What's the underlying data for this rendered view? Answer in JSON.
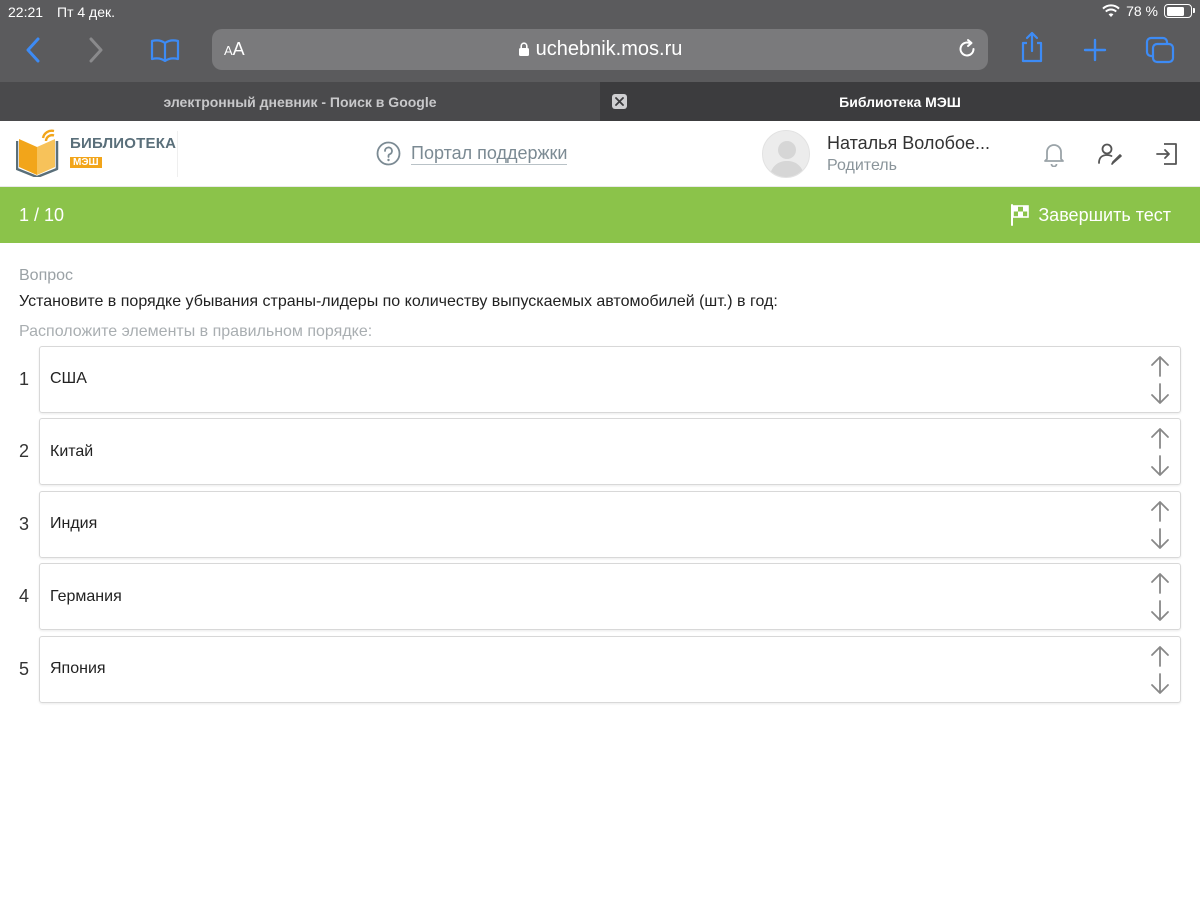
{
  "status": {
    "time": "22:21",
    "date": "Пт 4 дек.",
    "battery": "78 %",
    "battery_level": 0.78
  },
  "browser": {
    "url_aa": "AA",
    "url": "uchebnik.mos.ru",
    "tabs": [
      {
        "title": "электронный дневник - Поиск в Google",
        "active": false
      },
      {
        "title": "Библиотека МЭШ",
        "active": true
      }
    ]
  },
  "header": {
    "logo_name": "БИБЛИОТЕКА",
    "logo_sub": "МЭШ",
    "support": "Портал поддержки",
    "user_name": "Наталья Волобое...",
    "user_role": "Родитель"
  },
  "testbar": {
    "counter": "1 / 10",
    "finish": "Завершить тест"
  },
  "question": {
    "label": "Вопрос",
    "text": "Установите в порядке убывания страны-лидеры по количеству выпускаемых автомобилей (шт.) в год:",
    "hint": "Расположите элементы в правильном порядке:",
    "items": [
      {
        "num": "1",
        "label": "США"
      },
      {
        "num": "2",
        "label": "Китай"
      },
      {
        "num": "3",
        "label": "Индия"
      },
      {
        "num": "4",
        "label": "Германия"
      },
      {
        "num": "5",
        "label": "Япония"
      }
    ]
  },
  "colors": {
    "accent_green": "#8bc34a",
    "chrome_gray": "#5b5b5d",
    "ios_blue": "#3d8bf5",
    "logo_orange": "#f2a51a"
  }
}
